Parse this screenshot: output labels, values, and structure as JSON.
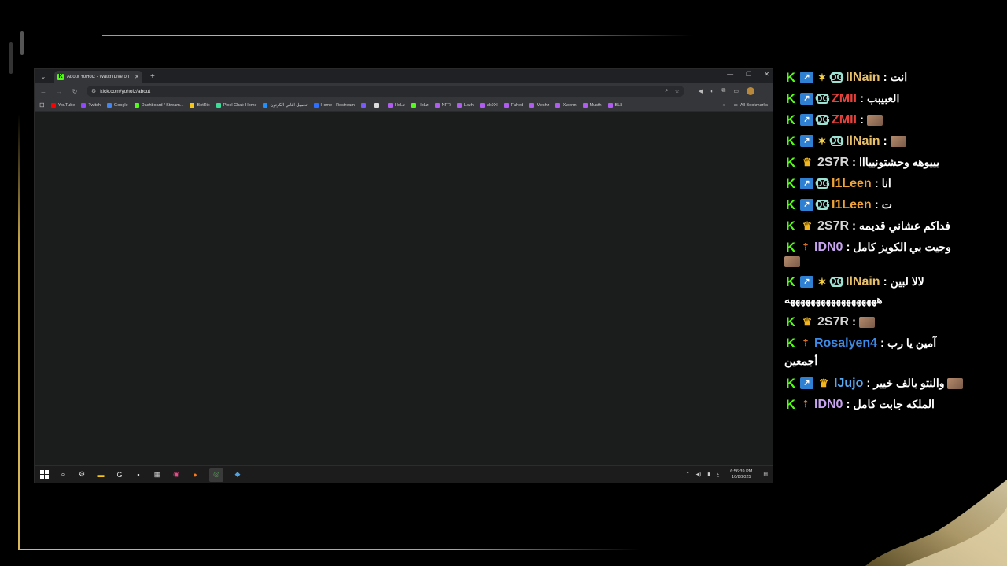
{
  "browser": {
    "tab_title": "About YoHolz - Watch Live on Kick",
    "url": "kick.com/yoholz/about",
    "bookmarks": [
      {
        "label": "YouTube",
        "color": "#ff0000"
      },
      {
        "label": "Twitch",
        "color": "#9146ff"
      },
      {
        "label": "Google",
        "color": "#4285f4"
      },
      {
        "label": "Dashboard / Stream...",
        "color": "#53fc18"
      },
      {
        "label": "BotRix",
        "color": "#f5c518"
      },
      {
        "label": "Pixel Chat: Home",
        "color": "#3ddc97"
      },
      {
        "label": "تحميل اغاني الكرتون",
        "color": "#1e90ff"
      },
      {
        "label": "Home - Restream",
        "color": "#2f6fff"
      },
      {
        "label": "",
        "color": "#7a5aff"
      },
      {
        "label": "",
        "color": "#dddddd"
      },
      {
        "label": "HoLz",
        "color": "#b05cf0"
      },
      {
        "label": "HoLz",
        "color": "#53fc18"
      },
      {
        "label": "NFR",
        "color": "#b05cf0"
      },
      {
        "label": "Lozh",
        "color": "#b05cf0"
      },
      {
        "label": "ak9Xl",
        "color": "#b05cf0"
      },
      {
        "label": "Fahed",
        "color": "#b05cf0"
      },
      {
        "label": "Meshz",
        "color": "#b05cf0"
      },
      {
        "label": "Xwerm",
        "color": "#b05cf0"
      },
      {
        "label": "Musth",
        "color": "#b05cf0"
      },
      {
        "label": "BL8",
        "color": "#b05cf0"
      }
    ],
    "all_bookmarks": "All Bookmarks"
  },
  "taskbar": {
    "time": "6:56:39 PM",
    "date": "10/8/2025",
    "lang": "ع"
  },
  "chat": {
    "messages": [
      {
        "badges": [
          "kick",
          "boost",
          "star",
          "og"
        ],
        "user": "IlNain",
        "color": "#e8c06a",
        "text": "انت",
        "emote": false
      },
      {
        "badges": [
          "kick",
          "boost",
          "og"
        ],
        "user": "ZMII",
        "color": "#e8413c",
        "text": "العبيبب",
        "emote": false
      },
      {
        "badges": [
          "kick",
          "boost",
          "og"
        ],
        "user": "ZMII",
        "color": "#e8413c",
        "text": "",
        "emote": true
      },
      {
        "badges": [
          "kick",
          "boost",
          "star",
          "og"
        ],
        "user": "IlNain",
        "color": "#e8c06a",
        "text": "",
        "emote": true
      },
      {
        "badges": [
          "kick",
          "crown"
        ],
        "user": "2S7R",
        "color": "#d6d6d6",
        "text": "يييوهه وحشتونييااا",
        "emote": false
      },
      {
        "badges": [
          "kick",
          "boost",
          "og"
        ],
        "user": "I1Leen",
        "color": "#f0a23a",
        "text": "انا",
        "emote": false
      },
      {
        "badges": [
          "kick",
          "boost",
          "og"
        ],
        "user": "I1Leen",
        "color": "#f0a23a",
        "text": "ت",
        "emote": false
      },
      {
        "badges": [
          "kick",
          "crown"
        ],
        "user": "2S7R",
        "color": "#d6d6d6",
        "text": "فداكم عشاني قديمه",
        "emote": false
      },
      {
        "badges": [
          "kick",
          "rocket"
        ],
        "user": "IDN0",
        "color": "#c7a3f0",
        "text": "وجيت بي الكويز كامل",
        "emote": true
      },
      {
        "badges": [
          "kick",
          "boost",
          "star",
          "og"
        ],
        "user": "IlNain",
        "color": "#e8c06a",
        "text": "لالا لبين",
        "text2": "ههههههههههههههههههه",
        "emote": false
      },
      {
        "badges": [
          "kick",
          "crown"
        ],
        "user": "2S7R",
        "color": "#d6d6d6",
        "text": "",
        "emote": true
      },
      {
        "badges": [
          "kick",
          "rocket"
        ],
        "user": "Rosalyen4",
        "color": "#3d8be8",
        "text": "آمين يا رب",
        "text2": "أجمعين",
        "emote": false
      },
      {
        "badges": [
          "kick",
          "boost",
          "crown"
        ],
        "user": "IJujo",
        "color": "#5aa8f0",
        "text": "والنتو بالف خيير",
        "emote": true
      },
      {
        "badges": [
          "kick",
          "rocket"
        ],
        "user": "IDN0",
        "color": "#c7a3f0",
        "text": "الملكه جابت كامل",
        "emote": false
      }
    ]
  }
}
